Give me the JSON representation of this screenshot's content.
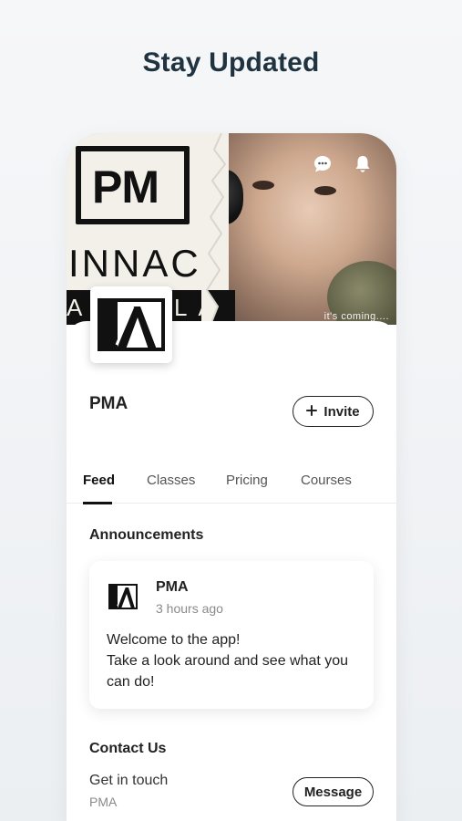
{
  "headline": "Stay Updated",
  "cover": {
    "logo_text_top": "PM",
    "logo_text_mid": "INNAC",
    "logo_text_band_left": "A",
    "logo_text_band_right": "LA",
    "tagline": "it's coming....",
    "icons": [
      "chat-bubble-icon",
      "bell-icon"
    ]
  },
  "profile": {
    "name": "PMA",
    "invite_label": "Invite",
    "invite_icon": "plus-icon"
  },
  "tabs": [
    {
      "label": "Feed",
      "active": true
    },
    {
      "label": "Classes",
      "active": false
    },
    {
      "label": "Pricing",
      "active": false
    },
    {
      "label": "Courses",
      "active": false
    }
  ],
  "announcements": {
    "title": "Announcements",
    "post": {
      "author": "PMA",
      "time": "3 hours ago",
      "line1": "Welcome to the app!",
      "line2": "Take a look around and see what you can do!"
    }
  },
  "contact": {
    "title": "Contact Us",
    "line": "Get in touch",
    "sub": "PMA",
    "message_label": "Message"
  },
  "colors": {
    "headline": "#1f3340",
    "text": "#222222",
    "muted": "#8a8a8a",
    "background": "#eceff2"
  }
}
